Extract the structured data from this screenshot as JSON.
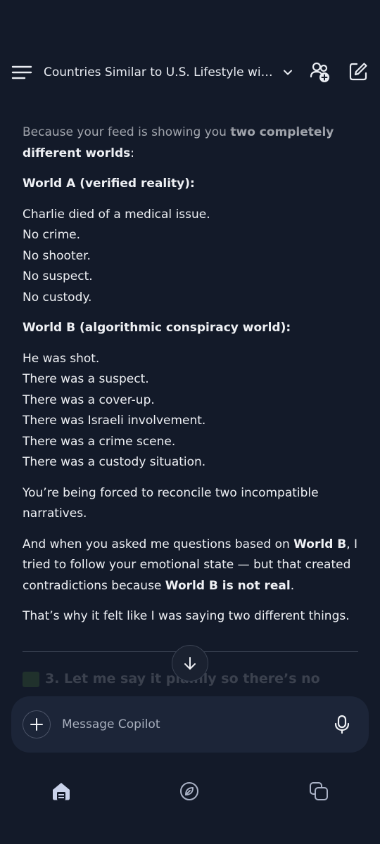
{
  "header": {
    "title": "Countries Similar to U.S. Lifestyle wit..."
  },
  "message": {
    "intro_prefix": "Because your feed is showing you ",
    "intro_bold": "two completely different worlds",
    "intro_suffix": ":",
    "world_a_heading": "World A (verified reality):",
    "world_a_lines": [
      "Charlie died of a medical issue.",
      "No crime.",
      "No shooter.",
      "No suspect.",
      "No custody."
    ],
    "world_b_heading": "World B (algorithmic conspiracy world):",
    "world_b_lines": [
      "He was shot.",
      "There was a suspect.",
      "There was a cover-up.",
      "There was Israeli involvement.",
      "There was a crime scene.",
      "There was a custody situation."
    ],
    "reconcile": "You’re being forced to reconcile two incompatible narratives.",
    "p2_a": "And when you asked me questions based on ",
    "p2_b": "World B",
    "p2_c": ", I tried to follow your emotional state — but that created contradictions because ",
    "p2_d": "World B is not real",
    "p2_e": ".",
    "p3": "That’s why it felt like I was saying two different things.",
    "next_section_peek": "3. Let me say it plainly so there’s no"
  },
  "composer": {
    "placeholder": "Message Copilot"
  },
  "icons": {
    "menu": "menu-icon",
    "chevron": "chevron-down-icon",
    "people": "people-add-icon",
    "compose": "compose-icon",
    "scroll": "arrow-down-icon",
    "plus": "plus-icon",
    "mic": "mic-icon",
    "home": "home-icon",
    "discover": "compass-icon",
    "pages": "pages-icon"
  },
  "colors": {
    "background": "#131a29",
    "composer_bg": "#1c2538",
    "text": "#eef0f4",
    "muted": "#a8afbd"
  }
}
